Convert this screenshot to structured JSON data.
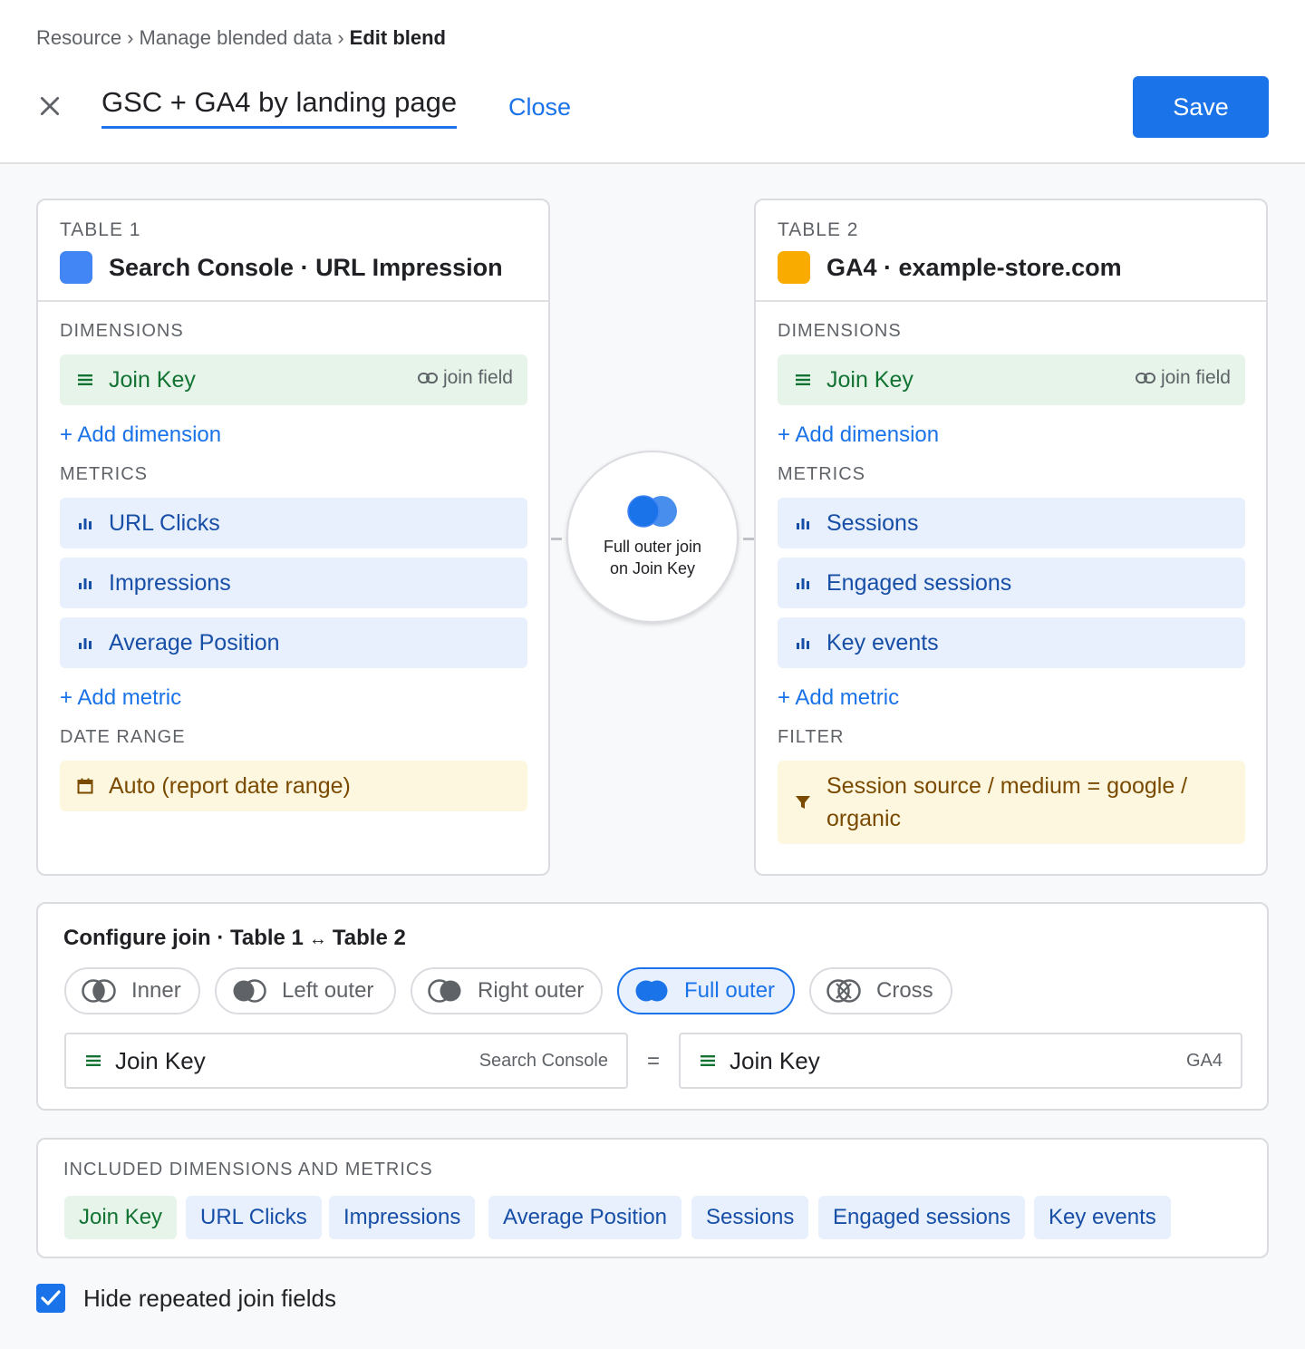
{
  "breadcrumb": {
    "items": [
      "Resource",
      "Manage blended data"
    ],
    "current": "Edit blend",
    "separator": "›"
  },
  "header": {
    "title": "GSC + GA4 by landing page",
    "close_label": "Close",
    "save_label": "Save"
  },
  "colors": {
    "accent": "#1a73e8",
    "table1_swatch": "#4285f4",
    "table2_swatch": "#f9ab00",
    "dimension": "#137333",
    "metric": "#174ea6"
  },
  "table1": {
    "label": "TABLE 1",
    "name": "Search Console · URL Impression",
    "dimensions_label": "DIMENSIONS",
    "dimensions": [
      {
        "name": "Join Key",
        "aside": "join field"
      }
    ],
    "add_dimension": "+ Add dimension",
    "metrics_label": "METRICS",
    "metrics": [
      "URL Clicks",
      "Impressions",
      "Average Position"
    ],
    "add_metric": "+ Add metric",
    "extra_label": "DATE RANGE",
    "extra_value": "Auto (report date range)"
  },
  "table2": {
    "label": "TABLE 2",
    "name": "GA4 · example-store.com",
    "dimensions_label": "DIMENSIONS",
    "dimensions": [
      {
        "name": "Join Key",
        "aside": "join field"
      }
    ],
    "add_dimension": "+ Add dimension",
    "metrics_label": "METRICS",
    "metrics": [
      "Sessions",
      "Engaged sessions",
      "Key events"
    ],
    "add_metric": "+ Add metric",
    "extra_label": "FILTER",
    "extra_value": "Session source / medium = google / organic"
  },
  "join_summary": {
    "line1": "Full outer join",
    "line2": "on Join Key"
  },
  "configure": {
    "title_prefix": "Configure join · Table 1",
    "arrow": "↔",
    "title_suffix": "Table 2",
    "options": [
      "Inner",
      "Left outer",
      "Right outer",
      "Full outer",
      "Cross"
    ],
    "selected": "Full outer",
    "left_key": {
      "field": "Join Key",
      "source": "Search Console"
    },
    "equals": "=",
    "right_key": {
      "field": "Join Key",
      "source": "GA4"
    }
  },
  "included": {
    "label": "INCLUDED DIMENSIONS AND METRICS",
    "dimensions": [
      "Join Key"
    ],
    "metrics": [
      "URL Clicks",
      "Impressions",
      "Average Position",
      "Sessions",
      "Engaged sessions",
      "Key events"
    ]
  },
  "options": {
    "hide_repeated_label": "Hide repeated join fields",
    "hide_repeated_checked": true
  }
}
